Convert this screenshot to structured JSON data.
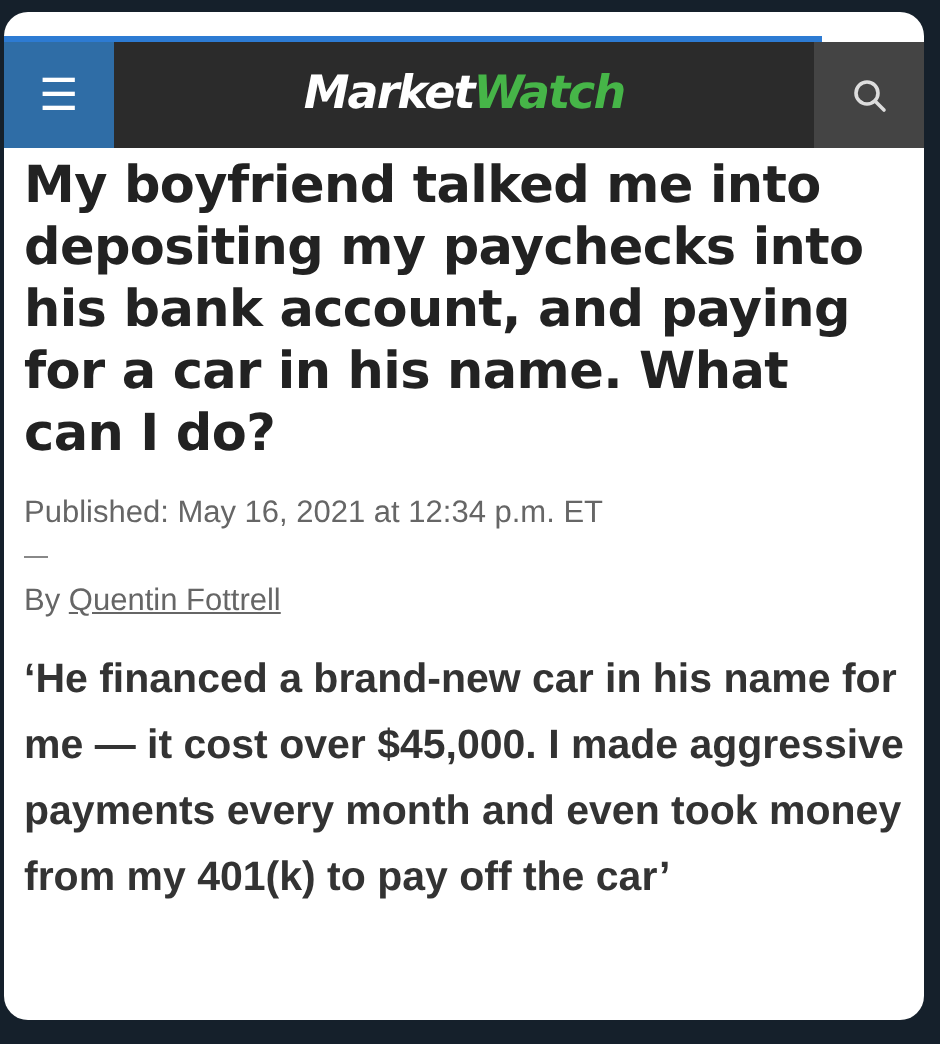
{
  "header": {
    "menu_icon": "☰",
    "logo": [
      "Market",
      "Watch"
    ],
    "progress": {
      "level": 0.89
    }
  },
  "article": {
    "headline": "My boyfriend talked me into depositing my paychecks into his bank account, and paying for a car in his name. What can I do?",
    "published": "Published: May 16, 2021 at 12:34 p.m. ET",
    "byline_prefix": "By",
    "author": "Quentin Fottrell",
    "subheading": "‘He financed a brand-new car in his name for me — it cost over $45,000. I made aggressive payments every month and even took money from my 401(k) to pay off the car’"
  }
}
